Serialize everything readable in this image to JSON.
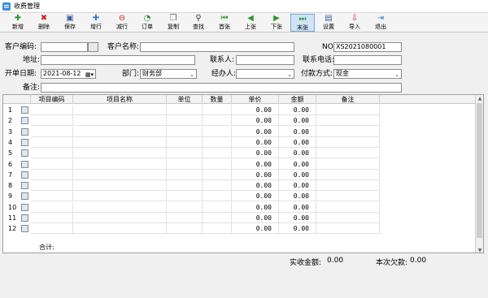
{
  "window": {
    "title": "收费管理"
  },
  "toolbar": [
    {
      "label": "新增",
      "icon": "add-icon",
      "color": "#2b9a2b",
      "glyph": "✚"
    },
    {
      "label": "删除",
      "icon": "delete-icon",
      "color": "#d02020",
      "glyph": "✖"
    },
    {
      "label": "保存",
      "icon": "save-icon",
      "color": "#3a5fa0",
      "glyph": "▣"
    },
    {
      "label": "增行",
      "icon": "add-row-icon",
      "color": "#2f7fd0",
      "glyph": "✚"
    },
    {
      "label": "减行",
      "icon": "remove-row-icon",
      "color": "#d02020",
      "glyph": "⊖"
    },
    {
      "label": "订单",
      "icon": "order-icon",
      "color": "#2b8a3a",
      "glyph": "◔"
    },
    {
      "label": "复制",
      "icon": "copy-icon",
      "color": "#6a6a6a",
      "glyph": "❐"
    },
    {
      "label": "查找",
      "icon": "find-icon",
      "color": "#3b3b3b",
      "glyph": "⚲"
    },
    {
      "label": "首张",
      "icon": "first-icon",
      "color": "#2b9a2b",
      "glyph": "⏮"
    },
    {
      "label": "上张",
      "icon": "prev-icon",
      "color": "#2b9a2b",
      "glyph": "◀"
    },
    {
      "label": "下张",
      "icon": "next-icon",
      "color": "#2b9a2b",
      "glyph": "▶"
    },
    {
      "label": "末张",
      "icon": "last-icon",
      "color": "#2b9a2b",
      "glyph": "⏭"
    },
    {
      "label": "设置",
      "icon": "settings-icon",
      "color": "#3a5fa0",
      "glyph": "▤"
    },
    {
      "label": "导入",
      "icon": "import-icon",
      "color": "#c02850",
      "glyph": "⇩"
    },
    {
      "label": "退出",
      "icon": "exit-icon",
      "color": "#2f7fd0",
      "glyph": "⇥"
    }
  ],
  "form": {
    "customer_code": {
      "label": "客户编码:",
      "value": ""
    },
    "customer_name": {
      "label": "客户名称:",
      "value": ""
    },
    "no": {
      "label": "NO:",
      "value": "XS2021080001"
    },
    "address": {
      "label": "地址:",
      "value": ""
    },
    "contact": {
      "label": "联系人:",
      "value": ""
    },
    "phone": {
      "label": "联系电话:",
      "value": ""
    },
    "date": {
      "label": "开单日期:",
      "value": "2021-08-12"
    },
    "department": {
      "label": "部门:",
      "value": "财务部"
    },
    "handler": {
      "label": "经办人:",
      "value": ""
    },
    "payment": {
      "label": "付款方式:",
      "value": "现金"
    },
    "remark": {
      "label": "备注:",
      "value": ""
    }
  },
  "grid": {
    "columns": [
      "项目编码",
      "项目名称",
      "单位",
      "数量",
      "单价",
      "金额",
      "备注"
    ],
    "rows": [
      {
        "n": "1",
        "price": "0.00",
        "amount": "0.00"
      },
      {
        "n": "2",
        "price": "0.00",
        "amount": "0.00"
      },
      {
        "n": "3",
        "price": "0.00",
        "amount": "0.00"
      },
      {
        "n": "4",
        "price": "0.00",
        "amount": "0.00"
      },
      {
        "n": "5",
        "price": "0.00",
        "amount": "0.00"
      },
      {
        "n": "6",
        "price": "0.00",
        "amount": "0.00"
      },
      {
        "n": "7",
        "price": "0.00",
        "amount": "0.00"
      },
      {
        "n": "8",
        "price": "0.00",
        "amount": "0.00"
      },
      {
        "n": "9",
        "price": "0.00",
        "amount": "0.00"
      },
      {
        "n": "10",
        "price": "0.00",
        "amount": "0.00"
      },
      {
        "n": "11",
        "price": "0.00",
        "amount": "0.00"
      },
      {
        "n": "12",
        "price": "0.00",
        "amount": "0.00"
      }
    ],
    "total_label": "合计:"
  },
  "footer": {
    "received_label": "实收金额:",
    "received_value": "0.00",
    "owed_label": "本次欠款:",
    "owed_value": "0.00"
  }
}
